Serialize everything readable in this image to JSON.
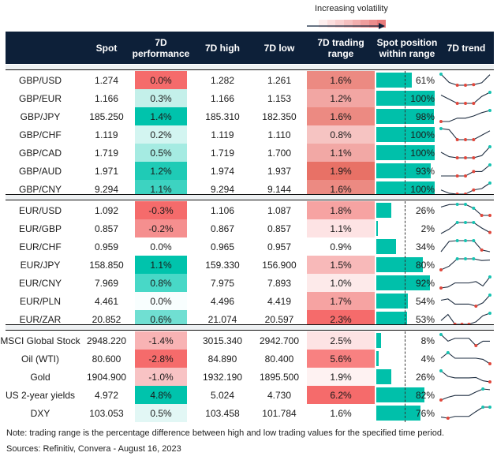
{
  "legend": {
    "label": "Increasing volatility",
    "gradient": [
      "#fdeeee",
      "#fbdede",
      "#f8cfcf",
      "#f5bfbf",
      "#f2aeae",
      "#ef9d9d",
      "#ec8c8c",
      "#e97b7b"
    ]
  },
  "header": {
    "columns": [
      "",
      "Spot",
      "7D performance",
      "7D high",
      "7D low",
      "7D trading range",
      "Spot position within range",
      "7D trend"
    ]
  },
  "colors": {
    "header_bg": "#0d2039",
    "bar": "#00c0aa",
    "up_marker": "#17c3b2",
    "down_marker": "#e0473c",
    "sparkline": "#1e2d40"
  },
  "groups": [
    {
      "rows": [
        {
          "name": "GBP/USD",
          "spot": "1.274",
          "perf": "0.0%",
          "perf_color": "#f56b6b",
          "high": "1.282",
          "low": "1.261",
          "range": "1.6%",
          "range_color": "#ec8a82",
          "pos": 61,
          "pos_label": "61%",
          "trend": [
            4,
            1,
            0,
            0,
            0.2,
            0.9,
            3.8
          ],
          "trend_hi": [
            0
          ],
          "trend_lo": [
            2,
            3,
            4
          ]
        },
        {
          "name": "GBP/EUR",
          "spot": "1.166",
          "perf": "0.3%",
          "perf_color": "#c4f0ea",
          "high": "1.166",
          "low": "1.153",
          "range": "1.2%",
          "range_color": "#f2a6a3",
          "pos": 100,
          "pos_label": "100%",
          "trend": [
            3,
            1.5,
            0,
            0,
            0,
            2.5,
            4
          ],
          "trend_hi": [
            6
          ],
          "trend_lo": [
            2,
            3,
            4
          ]
        },
        {
          "name": "GBP/JPY",
          "spot": "185.250",
          "perf": "1.4%",
          "perf_color": "#00c3ac",
          "high": "185.310",
          "low": "182.350",
          "range": "1.6%",
          "range_color": "#ec8a82",
          "pos": 98,
          "pos_label": "98%",
          "trend": [
            0,
            0,
            1.5,
            1.5,
            2.5,
            4,
            5
          ],
          "trend_hi": [
            6
          ],
          "trend_lo": [
            0
          ]
        },
        {
          "name": "GBP/CHF",
          "spot": "1.119",
          "perf": "0.2%",
          "perf_color": "#d3f5f1",
          "high": "1.119",
          "low": "1.110",
          "range": "0.8%",
          "range_color": "#f6c4c2",
          "pos": 100,
          "pos_label": "100%",
          "trend": [
            5,
            4.5,
            0,
            0,
            0,
            2,
            4
          ],
          "trend_hi": [
            0
          ],
          "trend_lo": [
            2,
            3,
            4
          ]
        },
        {
          "name": "GBP/CAD",
          "spot": "1.719",
          "perf": "0.5%",
          "perf_color": "#a5ebe2",
          "high": "1.719",
          "low": "1.700",
          "range": "1.1%",
          "range_color": "#f2a8a5",
          "pos": 100,
          "pos_label": "100%",
          "trend": [
            2.5,
            0.5,
            0,
            0,
            0,
            1,
            5
          ],
          "trend_hi": [
            6
          ],
          "trend_lo": [
            2,
            3,
            4
          ]
        },
        {
          "name": "GBP/AUD",
          "spot": "1.971",
          "perf": "1.2%",
          "perf_color": "#1fcbb6",
          "high": "1.974",
          "low": "1.937",
          "range": "1.9%",
          "range_color": "#e87166",
          "pos": 93,
          "pos_label": "93%",
          "trend": [
            0,
            0,
            0,
            0,
            2,
            2,
            5
          ],
          "trend_hi": [
            6
          ],
          "trend_lo": [
            2,
            3,
            4
          ]
        },
        {
          "name": "GBP/CNY",
          "spot": "9.294",
          "perf": "1.1%",
          "perf_color": "#3dd3c1",
          "high": "9.294",
          "low": "9.144",
          "range": "1.6%",
          "range_color": "#ec8a82",
          "pos": 100,
          "pos_label": "100%",
          "trend": [
            1.5,
            0.3,
            0,
            0,
            1.5,
            2,
            4
          ],
          "trend_hi": [
            6
          ],
          "trend_lo": [
            2,
            3,
            4
          ]
        }
      ]
    },
    {
      "rows": [
        {
          "name": "EUR/USD",
          "spot": "1.092",
          "perf": "-0.3%",
          "perf_color": "#f56b6b",
          "high": "1.106",
          "low": "1.087",
          "range": "1.8%",
          "range_color": "#f6a3a2",
          "pos": 26,
          "pos_label": "26%",
          "trend": [
            3.5,
            4.5,
            4.6,
            4.6,
            3,
            0,
            0
          ],
          "trend_hi": [
            2,
            3,
            4
          ],
          "trend_lo": [
            5,
            6
          ]
        },
        {
          "name": "EUR/GBP",
          "spot": "0.857",
          "perf": "-0.2%",
          "perf_color": "#f58f8f",
          "high": "0.867",
          "low": "0.857",
          "range": "1.1%",
          "range_color": "#fde3e4",
          "pos": 2,
          "pos_label": "2%",
          "trend": [
            0,
            2,
            5,
            5,
            5,
            2.5,
            0.5
          ],
          "trend_hi": [
            2,
            3,
            4
          ],
          "trend_lo": [
            6
          ]
        },
        {
          "name": "EUR/CHF",
          "spot": "0.959",
          "perf": "0.0%",
          "perf_color": "#ffffff",
          "high": "0.965",
          "low": "0.957",
          "range": "0.9%",
          "range_color": "#ffffff",
          "pos": 34,
          "pos_label": "34%",
          "trend": [
            0,
            3,
            3.2,
            3.2,
            3.2,
            0.5,
            0
          ],
          "trend_hi": [
            2,
            3,
            4
          ],
          "trend_lo": [
            5
          ]
        },
        {
          "name": "EUR/JPY",
          "spot": "158.850",
          "perf": "1.1%",
          "perf_color": "#00c3ac",
          "high": "159.330",
          "low": "156.900",
          "range": "1.5%",
          "range_color": "#f8b9b9",
          "pos": 80,
          "pos_label": "80%",
          "trend": [
            0,
            1.5,
            4.5,
            4.5,
            4.5,
            3.8,
            4
          ],
          "trend_hi": [
            2,
            3,
            4
          ],
          "trend_lo": [
            0
          ]
        },
        {
          "name": "EUR/CNY",
          "spot": "7.969",
          "perf": "0.8%",
          "perf_color": "#48d8c7",
          "high": "7.975",
          "low": "7.893",
          "range": "1.0%",
          "range_color": "#fdeaea",
          "pos": 92,
          "pos_label": "92%",
          "trend": [
            0,
            0.5,
            2.5,
            2.5,
            2.5,
            3.2,
            1,
            5.5
          ],
          "trend_hi": [
            7
          ],
          "trend_lo": [
            0
          ]
        },
        {
          "name": "EUR/PLN",
          "spot": "4.461",
          "perf": "0.0%",
          "perf_color": "#f8fefe",
          "high": "4.496",
          "low": "4.419",
          "range": "1.7%",
          "range_color": "#f6a3a2",
          "pos": 54,
          "pos_label": "54%",
          "trend": [
            2.5,
            3,
            1,
            1,
            1,
            0.2,
            1.5,
            4.5
          ],
          "trend_hi": [
            7
          ],
          "trend_lo": [
            5
          ]
        },
        {
          "name": "EUR/ZAR",
          "spot": "20.852",
          "perf": "0.6%",
          "perf_color": "#70dfd2",
          "high": "21.074",
          "low": "20.597",
          "range": "2.3%",
          "range_color": "#f56b6b",
          "pos": 53,
          "pos_label": "53%",
          "trend": [
            1.5,
            4,
            0,
            0,
            0,
            1,
            3.5,
            4.5
          ],
          "trend_hi": [
            7
          ],
          "trend_lo": [
            2,
            3,
            4
          ]
        }
      ]
    },
    {
      "rows": [
        {
          "name": "MSCI Global Stock",
          "spot": "2948.220",
          "perf": "-1.4%",
          "perf_color": "#f8b3b4",
          "high": "3015.340",
          "low": "2942.700",
          "range": "2.5%",
          "range_color": "#fde3e4",
          "pos": 8,
          "pos_label": "8%",
          "trend": [
            5,
            2,
            3.3,
            3.3,
            3.3,
            0,
            2,
            2
          ],
          "trend_hi": [
            0
          ],
          "trend_lo": [
            5
          ]
        },
        {
          "name": "Oil (WTI)",
          "spot": "80.600",
          "perf": "-2.8%",
          "perf_color": "#f56b6b",
          "high": "84.890",
          "low": "80.400",
          "range": "5.6%",
          "range_color": "#f88181",
          "pos": 4,
          "pos_label": "4%",
          "trend": [
            2.5,
            5,
            2.5,
            2.5,
            2.5,
            2.5,
            2,
            0
          ],
          "trend_hi": [
            1
          ],
          "trend_lo": [
            7
          ]
        },
        {
          "name": "Gold",
          "spot": "1904.900",
          "perf": "-1.0%",
          "perf_color": "#f8c3c4",
          "high": "1932.190",
          "low": "1895.500",
          "range": "1.9%",
          "range_color": "#fef2f2",
          "pos": 26,
          "pos_label": "26%",
          "trend": [
            5,
            2.5,
            1.8,
            1.8,
            1.8,
            2,
            0.5,
            0
          ],
          "trend_hi": [
            0
          ],
          "trend_lo": [
            7
          ]
        },
        {
          "name": "US 2-year yields",
          "spot": "4.972",
          "perf": "4.8%",
          "perf_color": "#00c3ac",
          "high": "5.024",
          "low": "4.730",
          "range": "6.2%",
          "range_color": "#f56b6b",
          "pos": 82,
          "pos_label": "82%",
          "trend": [
            0,
            1.2,
            2,
            2,
            2,
            3.5,
            4.8,
            4.5
          ],
          "trend_hi": [
            6
          ],
          "trend_lo": [
            0
          ]
        },
        {
          "name": "DXY",
          "spot": "103.053",
          "perf": "0.5%",
          "perf_color": "#e2f7f5",
          "high": "103.458",
          "low": "101.784",
          "range": "1.6%",
          "range_color": "#ffffff",
          "pos": 76,
          "pos_label": "76%",
          "trend": [
            0.5,
            0,
            0.8,
            0.8,
            0.8,
            3,
            5,
            5
          ],
          "trend_hi": [
            6,
            7
          ],
          "trend_lo": [
            1
          ]
        }
      ]
    }
  ],
  "notes": {
    "note": "Note: trading range is the percentage difference between high and low trading values for the specified time period.",
    "sources": "Sources: Refinitiv, Convera - August 16, 2023"
  }
}
